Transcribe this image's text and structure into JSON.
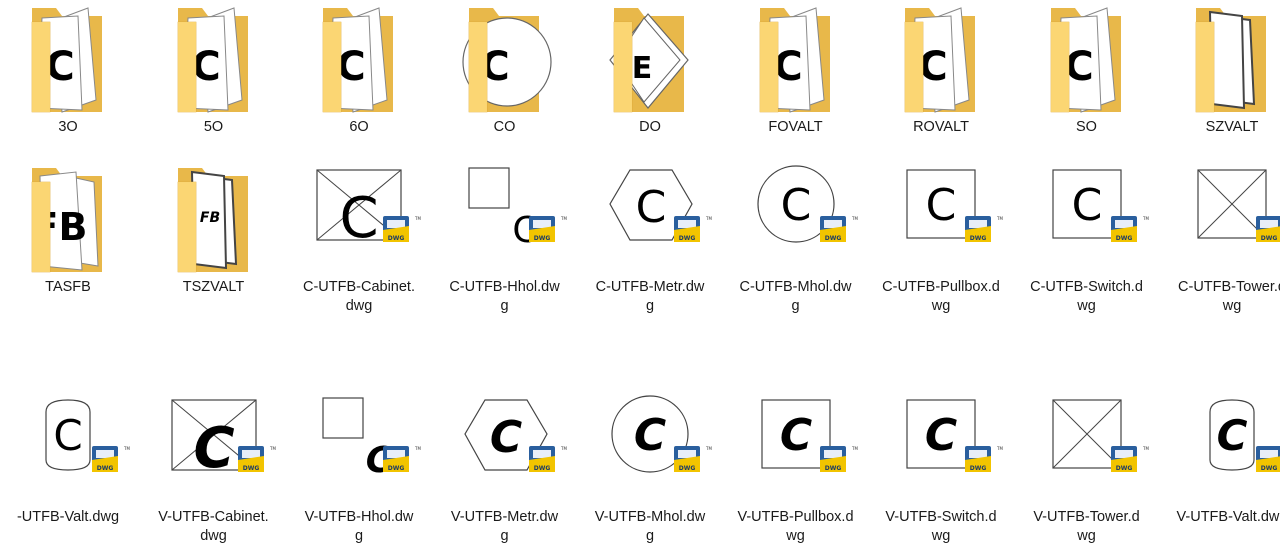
{
  "folders": [
    {
      "name": "3O",
      "glyph": "C",
      "style": "two-sheets"
    },
    {
      "name": "5O",
      "glyph": "C",
      "style": "two-sheets"
    },
    {
      "name": "6O",
      "glyph": "C",
      "style": "two-sheets"
    },
    {
      "name": "CO",
      "glyph": "C",
      "style": "circle"
    },
    {
      "name": "DO",
      "glyph": "E",
      "style": "diamond"
    },
    {
      "name": "FOVALT",
      "glyph": "C",
      "style": "two-sheets"
    },
    {
      "name": "ROVALT",
      "glyph": "C",
      "style": "two-sheets"
    },
    {
      "name": "SO",
      "glyph": "C",
      "style": "two-sheets"
    },
    {
      "name": "SZVALT",
      "glyph": "",
      "style": "frames"
    },
    {
      "name": "TASFB",
      "glyph": "FB",
      "style": "fb"
    },
    {
      "name": "TSZVALT",
      "glyph": "FB",
      "style": "frames-fb"
    }
  ],
  "dwg_files": [
    {
      "name": "C-UTFB-Cabinet.dwg",
      "line1": "C-UTFB-Cabinet.",
      "line2": "dwg",
      "shape": "box-x",
      "italic": false
    },
    {
      "name": "C-UTFB-Hhol.dwg",
      "line1": "C-UTFB-Hhol.dw",
      "line2": "g",
      "shape": "small-square",
      "italic": false
    },
    {
      "name": "C-UTFB-Metr.dwg",
      "line1": "C-UTFB-Metr.dw",
      "line2": "g",
      "shape": "hexagon",
      "italic": false
    },
    {
      "name": "C-UTFB-Mhol.dwg",
      "line1": "C-UTFB-Mhol.dw",
      "line2": "g",
      "shape": "circle",
      "italic": false
    },
    {
      "name": "C-UTFB-Pullbox.dwg",
      "line1": "C-UTFB-Pullbox.d",
      "line2": "wg",
      "shape": "square",
      "italic": false
    },
    {
      "name": "C-UTFB-Switch.dwg",
      "line1": "C-UTFB-Switch.d",
      "line2": "wg",
      "shape": "square",
      "italic": false
    },
    {
      "name": "C-UTFB-Tower.dwg",
      "line1": "C-UTFB-Tower.d",
      "line2": "wg",
      "shape": "x-only",
      "italic": false
    },
    {
      "name": "V-UTFB-Valt.dwg",
      "line1": "-UTFB-Valt.dwg",
      "line2": "",
      "shape": "rounded",
      "italic": false
    },
    {
      "name": "V-UTFB-Cabinet.dwg",
      "line1": "V-UTFB-Cabinet.",
      "line2": "dwg",
      "shape": "box-x",
      "italic": true
    },
    {
      "name": "V-UTFB-Hhol.dwg",
      "line1": "V-UTFB-Hhol.dw",
      "line2": "g",
      "shape": "small-square",
      "italic": true
    },
    {
      "name": "V-UTFB-Metr.dwg",
      "line1": "V-UTFB-Metr.dw",
      "line2": "g",
      "shape": "hexagon",
      "italic": true
    },
    {
      "name": "V-UTFB-Mhol.dwg",
      "line1": "V-UTFB-Mhol.dw",
      "line2": "g",
      "shape": "circle",
      "italic": true
    },
    {
      "name": "V-UTFB-Pullbox.dwg",
      "line1": "V-UTFB-Pullbox.d",
      "line2": "wg",
      "shape": "square",
      "italic": true
    },
    {
      "name": "V-UTFB-Switch.dwg",
      "line1": "V-UTFB-Switch.d",
      "line2": "wg",
      "shape": "square",
      "italic": true
    },
    {
      "name": "V-UTFB-Tower.dwg",
      "line1": "V-UTFB-Tower.d",
      "line2": "wg",
      "shape": "x-only",
      "italic": true
    },
    {
      "name": "V-UTFB-Valt.dwg",
      "line1": "V-UTFB-Valt.dwg",
      "line2": "",
      "shape": "rounded",
      "italic": true
    }
  ],
  "dwg_badge_text": "DWG",
  "dwg_badge_tm": "TM",
  "colors": {
    "folder_back": "#e8b84a",
    "folder_front": "#fbd673",
    "folder_edge": "#d9a431",
    "badge_yellow": "#f2c400",
    "badge_blue": "#2a5f9e",
    "text": "#1a1a1a"
  }
}
